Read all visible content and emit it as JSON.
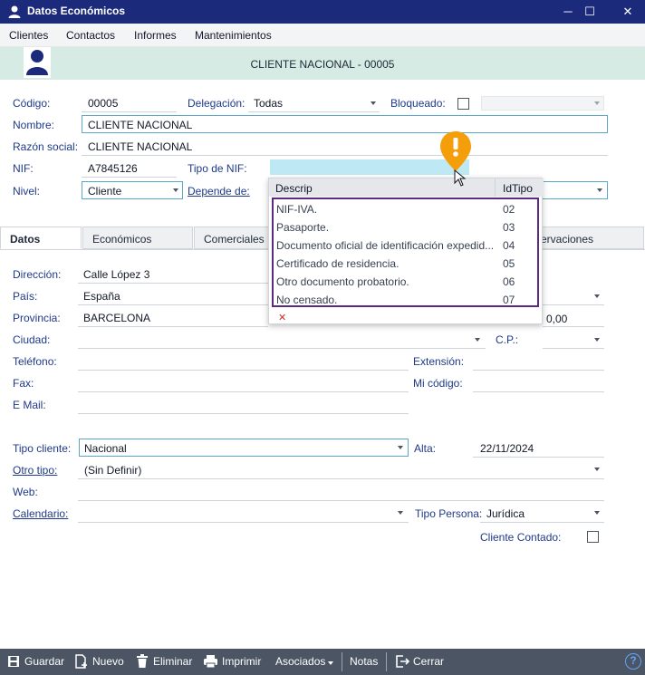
{
  "window": {
    "title": "Datos Económicos",
    "minimize": "─",
    "maximize": "☐",
    "close": "✕"
  },
  "menu": [
    "Clientes",
    "Contactos",
    "Informes",
    "Mantenimientos"
  ],
  "header": {
    "title": "CLIENTE NACIONAL - 00005"
  },
  "form_top": {
    "codigo": {
      "label": "Código:",
      "value": "00005"
    },
    "delegacion": {
      "label": "Delegación:",
      "value": "Todas"
    },
    "bloqueado": {
      "label": "Bloqueado:",
      "checked": false
    },
    "nombre": {
      "label": "Nombre:",
      "value": "CLIENTE NACIONAL"
    },
    "razon_social": {
      "label": "Razón social:",
      "value": "CLIENTE NACIONAL"
    },
    "nif": {
      "label": "NIF:",
      "value": "A7845126"
    },
    "tipo_nif": {
      "label": "Tipo de NIF:",
      "value": ""
    },
    "nivel": {
      "label": "Nivel:",
      "value": "Cliente"
    },
    "depende_de": {
      "label": "Depende de:",
      "value": ""
    }
  },
  "tabs": [
    "Datos",
    "Económicos",
    "Comerciales",
    "Observaciones"
  ],
  "tab_visible": {
    "observaciones_partial": "servaciones"
  },
  "datos": {
    "direccion": {
      "label": "Dirección:",
      "value": "Calle López 3"
    },
    "pais": {
      "label": "País:",
      "value": "España"
    },
    "provincia": {
      "label": "Provincia:",
      "value": "BARCELONA"
    },
    "provincia_extra": "0,00",
    "ciudad": {
      "label": "Ciudad:",
      "value": ""
    },
    "cp": {
      "label": "C.P.:",
      "value": ""
    },
    "telefono": {
      "label": "Teléfono:",
      "value": ""
    },
    "extension": {
      "label": "Extensión:",
      "value": ""
    },
    "fax": {
      "label": "Fax:",
      "value": ""
    },
    "mi_codigo": {
      "label": "Mi código:",
      "value": ""
    },
    "email": {
      "label": "E Mail:",
      "value": ""
    },
    "tipo_cliente": {
      "label": "Tipo cliente:",
      "value": "Nacional"
    },
    "alta": {
      "label": "Alta:",
      "value": "22/11/2024"
    },
    "otro_tipo": {
      "label": "Otro tipo:",
      "value": "(Sin Definir)"
    },
    "web": {
      "label": "Web:",
      "value": ""
    },
    "calendario": {
      "label": "Calendario:",
      "value": ""
    },
    "tipo_persona": {
      "label": "Tipo Persona:",
      "value": "Jurídica"
    },
    "cliente_contado": {
      "label": "Cliente Contado:",
      "checked": false
    }
  },
  "nif_popup": {
    "columns": [
      "Descrip",
      "IdTipo"
    ],
    "rows": [
      {
        "descrip": "NIF-IVA.",
        "id": "02"
      },
      {
        "descrip": "Pasaporte.",
        "id": "03"
      },
      {
        "descrip": "Documento oficial de identificación expedid...",
        "id": "04"
      },
      {
        "descrip": "Certificado de residencia.",
        "id": "05"
      },
      {
        "descrip": "Otro documento probatorio.",
        "id": "06"
      },
      {
        "descrip": "No censado.",
        "id": "07"
      }
    ],
    "clear_icon": "✕"
  },
  "toolbar": {
    "guardar": "Guardar",
    "nuevo": "Nuevo",
    "eliminar": "Eliminar",
    "imprimir": "Imprimir",
    "asociados": "Asociados",
    "notas": "Notas",
    "cerrar": "Cerrar",
    "help": "?"
  },
  "colors": {
    "titlebar": "#1b2a7a",
    "header_band": "#d6ebe3",
    "label": "#1e3a8a",
    "highlight": "#5b2a86",
    "warning_pin": "#f59e0b",
    "toolbar": "#4b5563",
    "field_focus": "#bfe8f5"
  }
}
